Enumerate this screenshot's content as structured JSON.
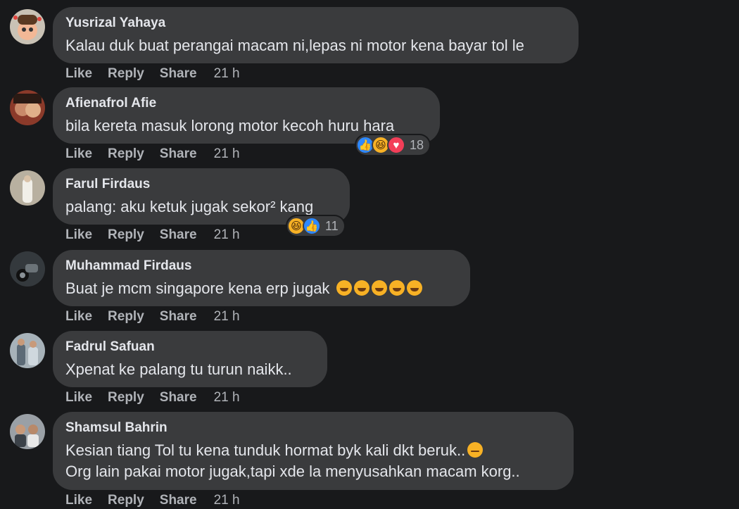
{
  "actions": {
    "like": "Like",
    "reply": "Reply",
    "share": "Share"
  },
  "colors": {
    "background": "#18191b",
    "bubble": "#3a3b3d",
    "like_blue": "#2d88ff",
    "haha_yellow": "#f7b125",
    "love_red": "#f33e58"
  },
  "comments": [
    {
      "name": "Yusrizal Yahaya",
      "text": "Kalau duk buat perangai macam ni,lepas ni motor kena bayar tol le",
      "time": "21 h",
      "avatar": "avatar-cartoon-icon"
    },
    {
      "name": "Afienafrol Afie",
      "text": "bila kereta masuk lorong motor kecoh huru hara",
      "time": "21 h",
      "reactions": {
        "icons": [
          "like-icon",
          "haha-icon",
          "love-icon"
        ],
        "count": "18"
      }
    },
    {
      "name": "Farul Firdaus",
      "text": "palang: aku ketuk jugak sekor² kang",
      "time": "21 h",
      "reactions": {
        "icons": [
          "haha-icon",
          "like-icon"
        ],
        "count": "11"
      }
    },
    {
      "name": "Muhammad Firdaus",
      "text": "Buat je mcm singapore kena erp jugak",
      "emoji": [
        "rofl-icon",
        "rofl-icon",
        "rofl-icon",
        "rofl-icon",
        "rofl-icon"
      ],
      "time": "21 h"
    },
    {
      "name": "Fadrul Safuan",
      "text": "Xpenat ke palang tu turun naikk..",
      "time": "21 h"
    },
    {
      "name": "Shamsul Bahrin",
      "text": "Kesian tiang Tol tu kena tunduk hormat byk kali dkt beruk..",
      "text2": "Org lain pakai motor jugak,tapi xde la menyusahkan macam korg..",
      "emoji_end": "expressionless-icon",
      "time": "21 h"
    }
  ]
}
